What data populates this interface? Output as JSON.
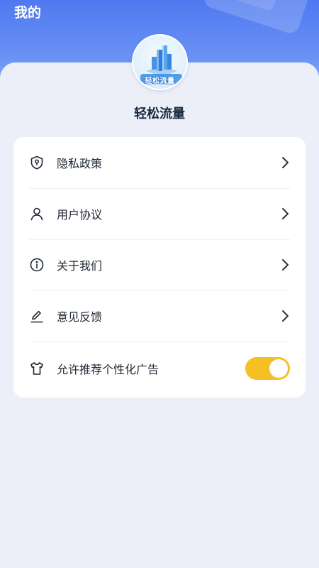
{
  "header": {
    "title": "我的"
  },
  "profile": {
    "app_name": "轻松流量",
    "logo_text": "轻松流量"
  },
  "menu": {
    "items": [
      {
        "label": "隐私政策",
        "icon": "shield-keyhole-icon"
      },
      {
        "label": "用户协议",
        "icon": "user-icon"
      },
      {
        "label": "关于我们",
        "icon": "info-icon"
      },
      {
        "label": "意见反馈",
        "icon": "pen-icon"
      }
    ],
    "ad_toggle": {
      "label": "允许推荐个性化广告",
      "icon": "shirt-icon",
      "enabled": true
    }
  },
  "colors": {
    "header_blue": "#4f79f0",
    "toggle_on": "#f5c024",
    "background": "#eceff7"
  }
}
